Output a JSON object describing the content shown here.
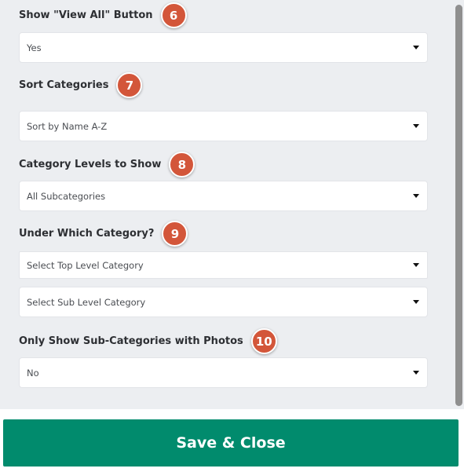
{
  "fields": [
    {
      "label": "Show \"View All\" Button",
      "badge": "6",
      "value": "Yes"
    },
    {
      "label": "Sort Categories",
      "badge": "7",
      "value": "Sort by Name A-Z"
    },
    {
      "label": "Category Levels to Show",
      "badge": "8",
      "value": "All Subcategories"
    },
    {
      "label": "Under Which Category?",
      "badge": "9",
      "value": "Select Top Level Category",
      "value2": "Select Sub Level Category"
    },
    {
      "label": "Only Show Sub-Categories with Photos",
      "badge": "10",
      "value": "No"
    }
  ],
  "save_button": {
    "label": "Save & Close"
  },
  "colors": {
    "panel_bg": "#eceef1",
    "badge": "#d3563a",
    "save_bg": "#018b6d"
  },
  "icons": {
    "caret": "caret-down-icon"
  }
}
